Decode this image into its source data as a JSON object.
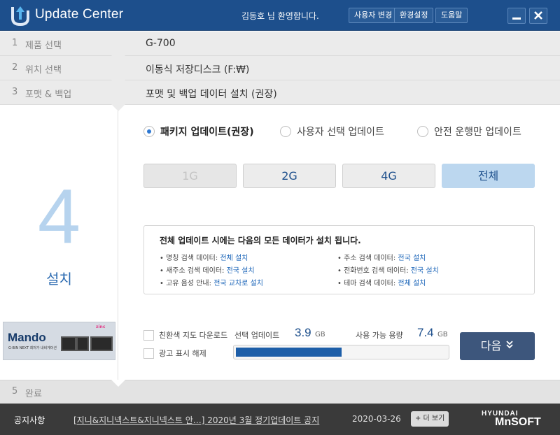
{
  "app": {
    "title": "Update Center",
    "welcome": "김동호  님 환영합니다."
  },
  "titlebar_buttons": {
    "change_user": "사용자 변경",
    "settings": "환경설정",
    "help": "도움말"
  },
  "steps": [
    {
      "num": "1",
      "label": "제품 선택",
      "value": "G-700"
    },
    {
      "num": "2",
      "label": "위치 선택",
      "value": "이동식 저장디스크 (F:₩)"
    },
    {
      "num": "3",
      "label": "포맷 & 백업",
      "value": "포맷 및 백업 데이터 설치 (권장)"
    },
    {
      "num": "5",
      "label": "완료"
    }
  ],
  "current_step": {
    "number": "4",
    "label": "설치"
  },
  "ad": {
    "brand": "Mando",
    "tagline": "G-BIN NEXT 최저가 내비게이션",
    "logo": "zinc"
  },
  "update_modes": [
    {
      "label": "패키지 업데이트(권장)",
      "selected": true
    },
    {
      "label": "사용자 선택 업데이트",
      "selected": false
    },
    {
      "label": "안전 운행만 업데이트",
      "selected": false
    }
  ],
  "size_options": [
    {
      "label": "1G",
      "state": "disabled"
    },
    {
      "label": "2G",
      "state": "normal"
    },
    {
      "label": "4G",
      "state": "normal"
    },
    {
      "label": "전체",
      "state": "active"
    }
  ],
  "info": {
    "title": "전체 업데이트 시에는 다음의 모든 데이터가 설치 됩니다.",
    "items": [
      {
        "label": "• 명칭 검색 데이터: ",
        "value": "전체 설치"
      },
      {
        "label": "• 주소 검색 데이터: ",
        "value": "전국 설치"
      },
      {
        "label": "• 새주소 검색 데이터: ",
        "value": "전국 설치"
      },
      {
        "label": "• 전화번호 검색 데이터: ",
        "value": "전국 설치"
      },
      {
        "label": "• 고유 음성 안내: ",
        "value": "전국 교차로 설치"
      },
      {
        "label": "• 테마 검색 데이터: ",
        "value": "전체 설치"
      }
    ]
  },
  "checkboxes": {
    "simple_map": "친환색 지도 다운로드",
    "hide_ads": "광고 표시 해제"
  },
  "stats": {
    "selected_label": "선택 업데이트",
    "selected_value": "3.9",
    "selected_unit": "GB",
    "available_label": "사용 가능 용량",
    "available_value": "7.4",
    "available_unit": "GB"
  },
  "progress": {
    "fraction": 0.5
  },
  "next_button": {
    "label": "다음",
    "icon": "double-chevron-down-icon"
  },
  "footer": {
    "notice_label": "공지사항",
    "notice_text": "[지니&지니넥스트&지니넥스트  안…] 2020년 3월 정기업데이트 공지",
    "notice_date": "2020-03-26",
    "more_label": "+ 더 보기",
    "brand_top": "HYUNDAI",
    "brand_bottom": "MnSOFT"
  },
  "colors": {
    "titlebar": "#1d4f8c",
    "accent": "#2d78d2",
    "active_option": "#bcd7ef",
    "next_button": "#3d567c",
    "footer": "#3a3a3a"
  }
}
